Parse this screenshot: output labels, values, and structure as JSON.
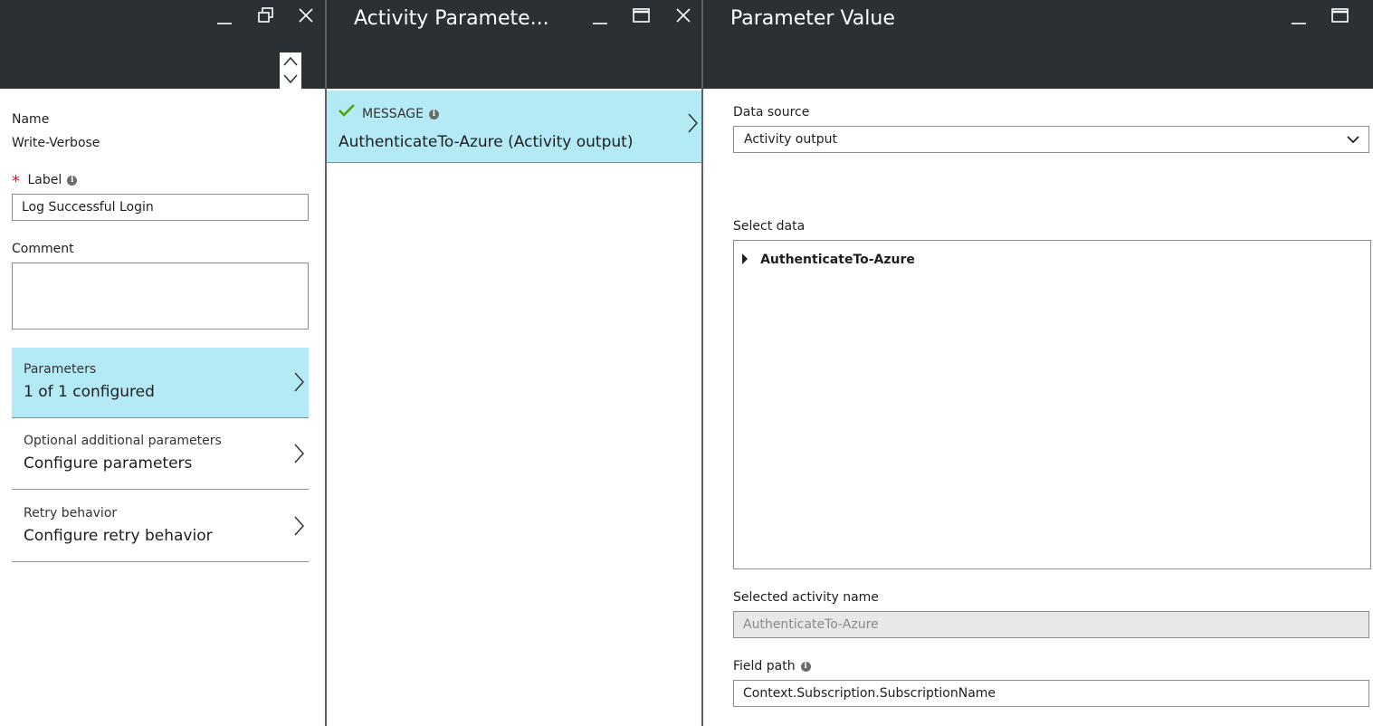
{
  "blade1": {
    "name_label": "Name",
    "name_value": "Write-Verbose",
    "label_required_marker": "*",
    "label_label": "Label",
    "label_value": "Log Successful Login",
    "comment_label": "Comment",
    "comment_value": "",
    "tiles": [
      {
        "label": "Parameters",
        "value": "1 of 1 configured"
      },
      {
        "label": "Optional additional parameters",
        "value": "Configure parameters"
      },
      {
        "label": "Retry behavior",
        "value": "Configure retry behavior"
      }
    ]
  },
  "blade2": {
    "title": "Activity Paramete...",
    "param": {
      "name": "MESSAGE",
      "value": "AuthenticateTo-Azure (Activity output)"
    }
  },
  "blade3": {
    "title": "Parameter Value",
    "data_source_label": "Data source",
    "data_source_value": "Activity output",
    "select_data_label": "Select data",
    "tree_item": "AuthenticateTo-Azure",
    "selected_activity_label": "Selected activity name",
    "selected_activity_value": "AuthenticateTo-Azure",
    "field_path_label": "Field path",
    "field_path_value": "Context.Subscription.SubscriptionName"
  },
  "colors": {
    "header_bg": "#2b3035",
    "selected_tile_bg": "#b4e9f6",
    "check_green": "#57a300",
    "required_red": "#e81123"
  },
  "icons": [
    "minimize-icon",
    "restore-icon",
    "maximize-icon",
    "close-icon",
    "scroll-up-icon",
    "scroll-down-icon",
    "chevron-right-icon",
    "chevron-down-icon",
    "checkmark-icon",
    "info-icon",
    "expand-triangle-icon"
  ]
}
